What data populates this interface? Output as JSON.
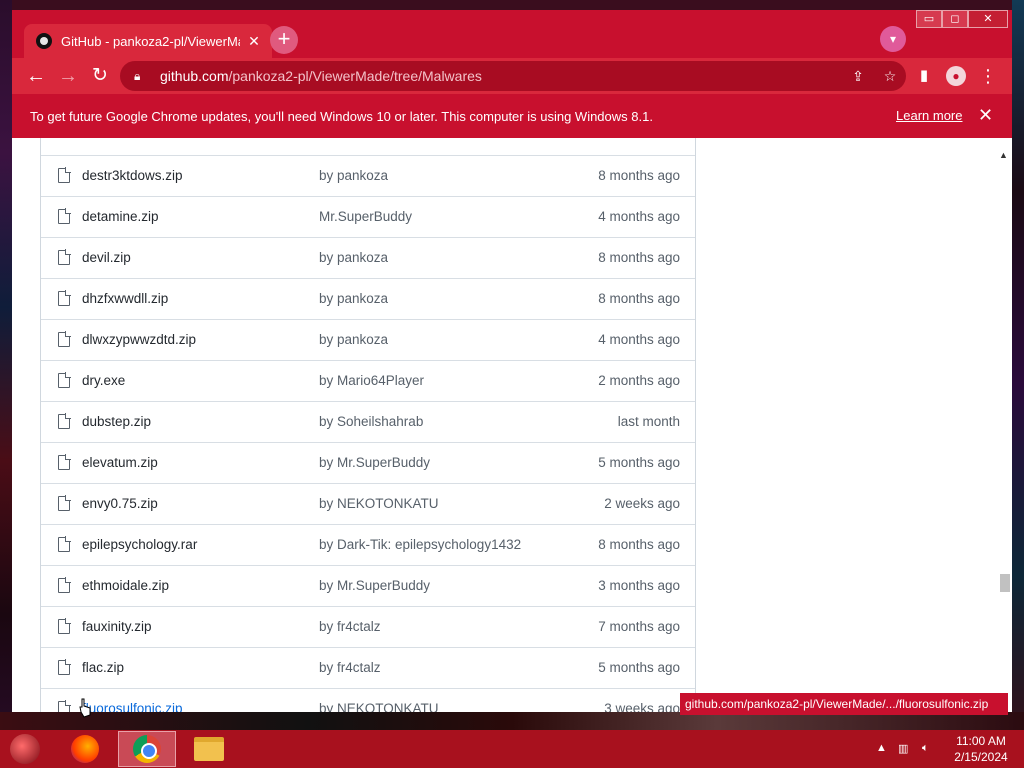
{
  "browser": {
    "tab_title": "GitHub - pankoza2-pl/ViewerMa",
    "tab_close": "✕",
    "new_tab": "+",
    "address_host": "github.com",
    "address_path": "/pankoza2-pl/ViewerMade/tree/Malwares",
    "window_controls": {
      "minimize": "▭",
      "maximize": "◻",
      "close": "✕"
    }
  },
  "infobar": {
    "message": "To get future Google Chrome updates, you'll need Windows 10 or later. This computer is using Windows 8.1.",
    "learn_more": "Learn more",
    "close": "✕"
  },
  "files": [
    {
      "name": "destr3ktdows.zip",
      "message": "by pankoza",
      "age": "8 months ago"
    },
    {
      "name": "detamine.zip",
      "message": "Mr.SuperBuddy",
      "age": "4 months ago"
    },
    {
      "name": "devil.zip",
      "message": "by pankoza",
      "age": "8 months ago"
    },
    {
      "name": "dhzfxwwdll.zip",
      "message": "by pankoza",
      "age": "8 months ago"
    },
    {
      "name": "dlwxzypwwzdtd.zip",
      "message": "by pankoza",
      "age": "4 months ago"
    },
    {
      "name": "dry.exe",
      "message": "by Mario64Player",
      "age": "2 months ago"
    },
    {
      "name": "dubstep.zip",
      "message": "by Soheilshahrab",
      "age": "last month"
    },
    {
      "name": "elevatum.zip",
      "message": "by Mr.SuperBuddy",
      "age": "5 months ago"
    },
    {
      "name": "envy0.75.zip",
      "message": "by NEKOTONKATU",
      "age": "2 weeks ago"
    },
    {
      "name": "epilepsychology.rar",
      "message": "by Dark-Tik: epilepsychology1432",
      "age": "8 months ago"
    },
    {
      "name": "ethmoidale.zip",
      "message": "by Mr.SuperBuddy",
      "age": "3 months ago"
    },
    {
      "name": "fauxinity.zip",
      "message": "by fr4ctalz",
      "age": "7 months ago"
    },
    {
      "name": "flac.zip",
      "message": "by fr4ctalz",
      "age": "5 months ago"
    },
    {
      "name": "fluorosulfonic.zip",
      "message": "by NEKOTONKATU",
      "age": "3 weeks ago"
    }
  ],
  "status_bar_url": "github.com/pankoza2-pl/ViewerMade/.../fluorosulfonic.zip",
  "taskbar": {
    "time": "11:00 AM",
    "date": "2/15/2024"
  },
  "colors": {
    "chrome_theme": "#c8102e",
    "link": "#0969da",
    "taskbar": "#a8111e"
  },
  "icons": [
    "github-icon",
    "back-icon",
    "forward-icon",
    "reload-icon",
    "lock-icon",
    "share-icon",
    "star-icon",
    "side-panel-icon",
    "profile-icon",
    "menu-icon",
    "file-icon",
    "firefox-icon",
    "chrome-icon",
    "file-explorer-icon"
  ]
}
